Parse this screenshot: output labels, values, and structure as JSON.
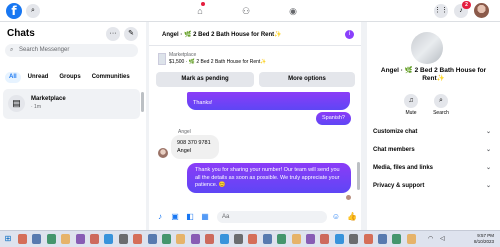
{
  "topbar": {
    "logo": "f",
    "search_icon": "⌕",
    "nav_icons": [
      "home-icon",
      "groups-icon",
      "gaming-icon"
    ],
    "notification_count": "2",
    "apps_icon": "menu-grid-icon"
  },
  "sidebar": {
    "title": "Chats",
    "search_placeholder": "Search Messenger",
    "filters": [
      "All",
      "Unread",
      "Groups",
      "Communities"
    ],
    "active_filter": "All",
    "chat": {
      "name": "Marketplace",
      "time": "· 1m"
    }
  },
  "conversation": {
    "title": "Angel · 🌿 2 Bed 2 Bath House for Rent✨",
    "marketplace_label": "Marketplace",
    "listing_detail": "$1,500 · 🌿 2 Bed 2 Bath House for Rent✨",
    "mark_pending_label": "Mark as pending",
    "more_options_label": "More options",
    "messages": [
      {
        "sender": "me",
        "text": "Thanks!"
      },
      {
        "sender": "me",
        "text": "Spanish?"
      },
      {
        "sender": "them_name",
        "text": "Angel"
      },
      {
        "sender": "them",
        "text": "908 370 9781\nAngel"
      },
      {
        "sender": "me",
        "text": "Thank you for sharing your number!     Our team will send you all the details as soon as possible. We truly appreciate your patience. 😊"
      }
    ],
    "composer_placeholder": "Aa"
  },
  "details": {
    "name": "Angel · 🌿 2 Bed 2 Bath House for Rent✨",
    "mute_label": "Mute",
    "search_label": "Search",
    "menu": [
      "Customize chat",
      "Chat members",
      "Media, files and links",
      "Privacy & support"
    ]
  },
  "taskbar": {
    "time": "9:57 PM",
    "date": "8/10/2023"
  },
  "colors": {
    "brand": "#1877f2",
    "bubble_out_top": "#8b3cf7",
    "bubble_out_bottom": "#5e46f5",
    "notification_red": "#e41e3f"
  }
}
